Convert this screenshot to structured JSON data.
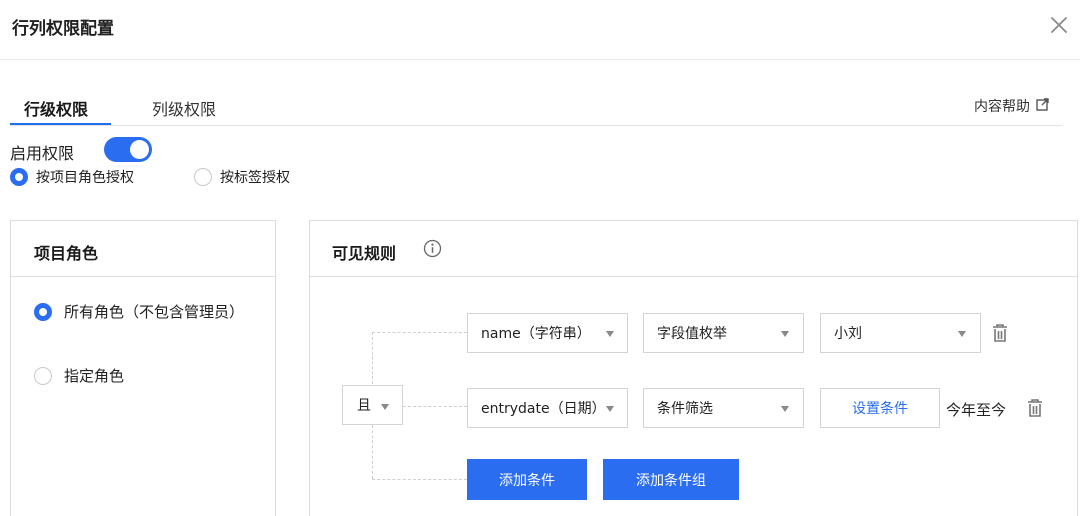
{
  "header": {
    "title": "行列权限配置",
    "close_icon": "close-icon"
  },
  "tabs": [
    {
      "label": "行级权限",
      "active": true
    },
    {
      "label": "列级权限",
      "active": false
    }
  ],
  "help": {
    "label": "内容帮助",
    "icon": "external-link-icon"
  },
  "permission": {
    "enable_label": "启用权限",
    "enabled": true,
    "modes": [
      {
        "label": "按项目角色授权",
        "selected": true
      },
      {
        "label": "按标签授权",
        "selected": false
      }
    ]
  },
  "roles_panel": {
    "title": "项目角色",
    "options": [
      {
        "label": "所有角色（不包含管理员）",
        "selected": true
      },
      {
        "label": "指定角色",
        "selected": false
      }
    ]
  },
  "rules_panel": {
    "title": "可见规则",
    "info_icon": "info-icon",
    "logic_operator": "且",
    "conditions": [
      {
        "field": "name（字符串）",
        "mode": "字段值枚举",
        "value": "小刘",
        "trash_icon": "trash-icon"
      },
      {
        "field": "entrydate（日期）",
        "mode": "条件筛选",
        "value_button": "设置条件",
        "value_text": "今年至今",
        "trash_icon": "trash-icon"
      }
    ],
    "add_condition_label": "添加条件",
    "add_group_label": "添加条件组"
  },
  "colors": {
    "accent": "#2b6df0",
    "border": "#dcdcdc"
  }
}
